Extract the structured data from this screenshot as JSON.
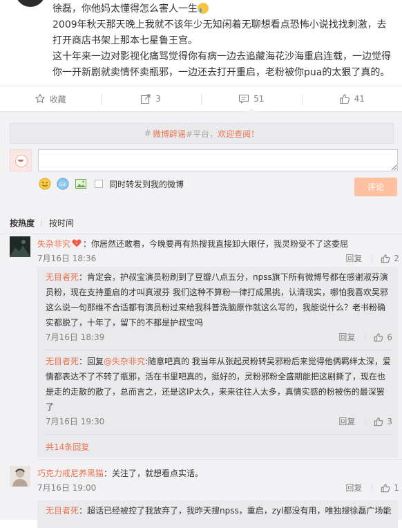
{
  "post": {
    "line1_prefix": "徐磊，你他妈太懂得怎么害人一生",
    "emoji": "crying-face",
    "paragraph2": "2009年秋天那天晚上我就不该年少无知闲着无聊想看点恐怖小说找找刺激，去打开商店书架上那本七星鲁王宫。",
    "paragraph3": "这十年来一边对影视化痛骂觉得你有病一边去追藏海花沙海重启连载，一边觉得你一开新剧就卖情怀卖瓶邪，一边还去打开重启，老粉被你pua的太狠了真的。"
  },
  "actions": {
    "favorite": {
      "icon": "star-icon",
      "label": "收藏"
    },
    "share": {
      "icon": "share-icon",
      "count": "3"
    },
    "comment": {
      "icon": "comment-icon",
      "count": "51"
    },
    "like": {
      "icon": "thumbs-up-icon",
      "count": "41"
    }
  },
  "notice": {
    "hash": "#",
    "link_text": "微博辟谣",
    "middle": "#平台，",
    "welcome": "欢迎查阅！"
  },
  "composer": {
    "input_value": "",
    "forward_label": "同时转发到我的微博",
    "submit_label": "评论",
    "tool_icons": [
      "smiley-icon",
      "gif-icon",
      "image-icon"
    ]
  },
  "sort": {
    "by_hot": "按热度",
    "by_time": "按时间"
  },
  "comments": [
    {
      "user": "失杂非究",
      "text": "：你居然还敢看，今晚要再有热搜我直接卸大眼仔，我灵粉受不了这委屈",
      "time": "7月16日 18:36",
      "reply": "回复",
      "likes": "2",
      "replies": [
        {
          "user": "无目者死",
          "text": "：肯定会，护叔宝演员粉刷到了豆瓣八点五分，npss旗下所有微博号都在感谢淑芬演员粉，现在支持重启的才叫真淑芬 我们这种不算粉一律打成黑挑，认清现实，哪怕我喜欢吴邪这么说一句那维不合适都有演员粉过来给我科普洗脑原作就这么写的，我能说什么？老书粉确实都脱了，十年了，留下的不都是护叔宝吗",
          "time": "7月16日 18:39",
          "reply": "回复",
          "likes": "6"
        },
        {
          "user": "无目者死",
          "reply_prefix": "：回复",
          "mention": "@失杂非究",
          "text": ":随意吧真的 我当年从张起灵粉转吴邪粉后来觉得他俩羁绊太深，爱情都表达不了不转了瓶邪，活在书里吧真的，挺好的，灵粉邪粉全盛期能把这剧撕了，现在也是走的走散的散了，总而言之，还是这IP太久，来来往往人太多，真情实感的粉被伤的最深罢了",
          "time": "7月16日 19:30",
          "reply": "回复",
          "likes": "3"
        }
      ],
      "more_replies": "共14条回复"
    },
    {
      "user": "巧克力戒尼养黑猫",
      "text": "：关注了，就想看点实话。",
      "time": "7月16日 19:00",
      "reply": "回复",
      "likes": "1",
      "replies": [
        {
          "user": "无目者死",
          "text": "：超话已经被控了我放弃了，我昨天搜npss，重启，zyl都没有用，唯独搜徐磊广场能"
        }
      ]
    }
  ],
  "colors": {
    "accent": "#eb7350",
    "submit_disabled": "#ffc09f",
    "comment_bg": "#f2f2f5",
    "reply_bg": "#eaeaec",
    "meta_gray": "#808080"
  }
}
